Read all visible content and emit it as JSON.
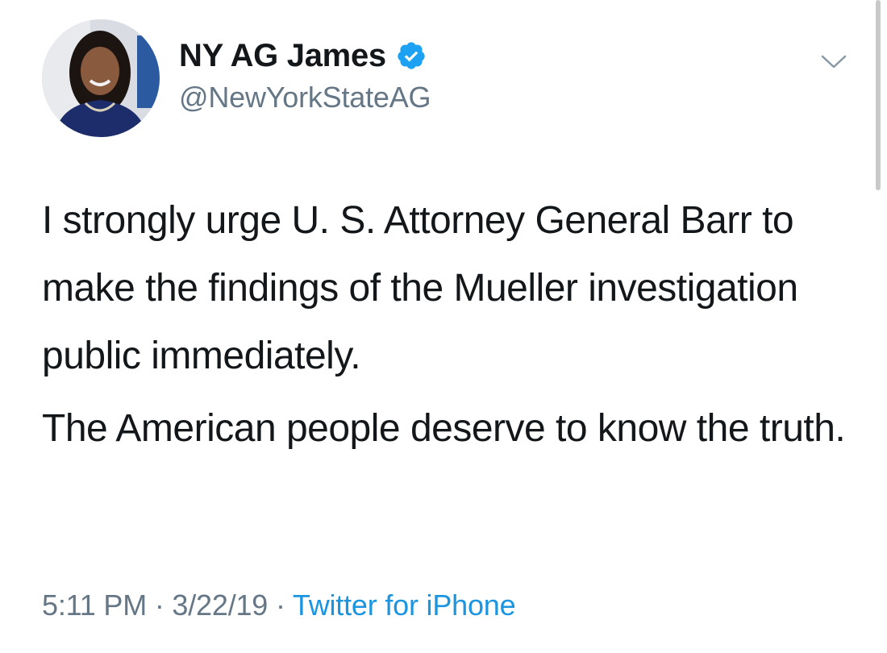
{
  "user": {
    "display_name": "NY AG James",
    "handle": "@NewYorkStateAG",
    "verified": true,
    "avatar_icon": "profile-photo"
  },
  "tweet": {
    "paragraphs": [
      "I strongly urge U. S. Attorney General Barr to make the findings of the Mueller investigation public immediately.",
      "The American people deserve to know the truth."
    ]
  },
  "meta": {
    "time": "5:11 PM",
    "separator": "·",
    "date": "3/22/19",
    "source": "Twitter for iPhone"
  },
  "icons": {
    "verified": "verified-badge-icon",
    "menu": "chevron-down-icon"
  },
  "colors": {
    "link_blue": "#1b95e0",
    "verified_blue": "#1da1f2",
    "secondary_text": "#657786",
    "primary_text": "#14171a"
  }
}
